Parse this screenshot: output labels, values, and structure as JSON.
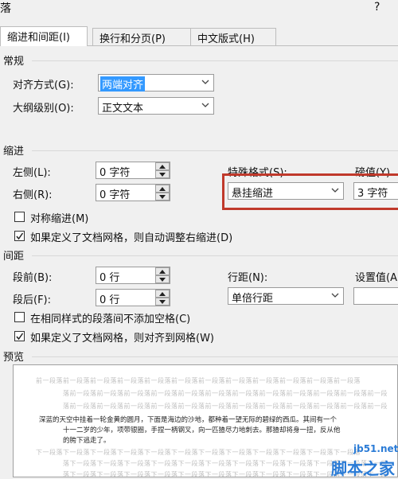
{
  "window": {
    "title": "落",
    "help": "?"
  },
  "tabs": [
    {
      "label": "缩进和间距(I)",
      "active": true
    },
    {
      "label": "换行和分页(P)",
      "active": false
    },
    {
      "label": "中文版式(H)",
      "active": false
    }
  ],
  "general": {
    "heading": "常规",
    "alignment_label": "对齐方式(G):",
    "alignment_value": "两端对齐",
    "outline_label": "大纲级别(O):",
    "outline_value": "正文文本"
  },
  "indent": {
    "heading": "缩进",
    "left_label": "左侧(L):",
    "left_value": "0 字符",
    "right_label": "右侧(R):",
    "right_value": "0 字符",
    "special_label": "特殊格式(S):",
    "special_value": "悬挂缩进",
    "by_label": "磅值(Y)",
    "by_value": "3 字符",
    "mirror_label": "对称缩进(M)",
    "mirror_checked": false,
    "auto_adjust_label": "如果定义了文档网格，则自动调整右缩进(D)",
    "auto_adjust_checked": true
  },
  "spacing": {
    "heading": "间距",
    "before_label": "段前(B):",
    "before_value": "0 行",
    "after_label": "段后(F):",
    "after_value": "0 行",
    "line_label": "行距(N):",
    "line_value": "单倍行距",
    "at_label": "设置值(A",
    "at_value": "",
    "no_space_label": "在相同样式的段落间不添加空格(C)",
    "no_space_checked": false,
    "snap_grid_label": "如果定义了文档网格，则对齐到网格(W)",
    "snap_grid_checked": true
  },
  "preview": {
    "heading": "预览",
    "prev_line1": "前一段落前一段落前一段落前一段落前一段落前一段落前一段落前一段落前一段落前一段落前一段落前一段落",
    "prev_line2": "落前一段落前一段落前一段落前一段落前一段落前一段落前一段落前一段落前一段落前一段落前一段落前一段",
    "prev_line3": "落前一段落前一段落前一段落前一段落前一段落前一段落前一段落前一段落前一段落前一段落前一段落前一段",
    "main_line1": "深蓝的天空中挂着一轮金黄的圆月，下面是海边的沙地，都种着一望无际的碧绿的西瓜。其间有一个",
    "main_line2": "十一二岁的少年，项带银圈，手捏一柄钢叉，向一匹猹尽力地刺去。那猹却将身一扭，反从他",
    "main_line3": "的胯下逃走了。",
    "next_line1": "下一段落下一段落下一段落下一段落下一段落下一段落下一段落下一段落下一段落下一段落下一段落下一段落",
    "next_line2": "落下一段落下一段落下一段落下一段落下一段落下一段落下一段落下一段落下一段落下一段落下一段落下一段",
    "next_line3": "落下一段落下一段落下一段落下一段落下一段落下一段落下一段落下一段落下一段落下一段落下一段落下一段"
  },
  "watermark": {
    "site": "jb51.net",
    "name": "脚本之家"
  },
  "colors": {
    "highlight": "#c0392b",
    "selection": "#3399ff",
    "watermark": "#2a7bd6"
  }
}
